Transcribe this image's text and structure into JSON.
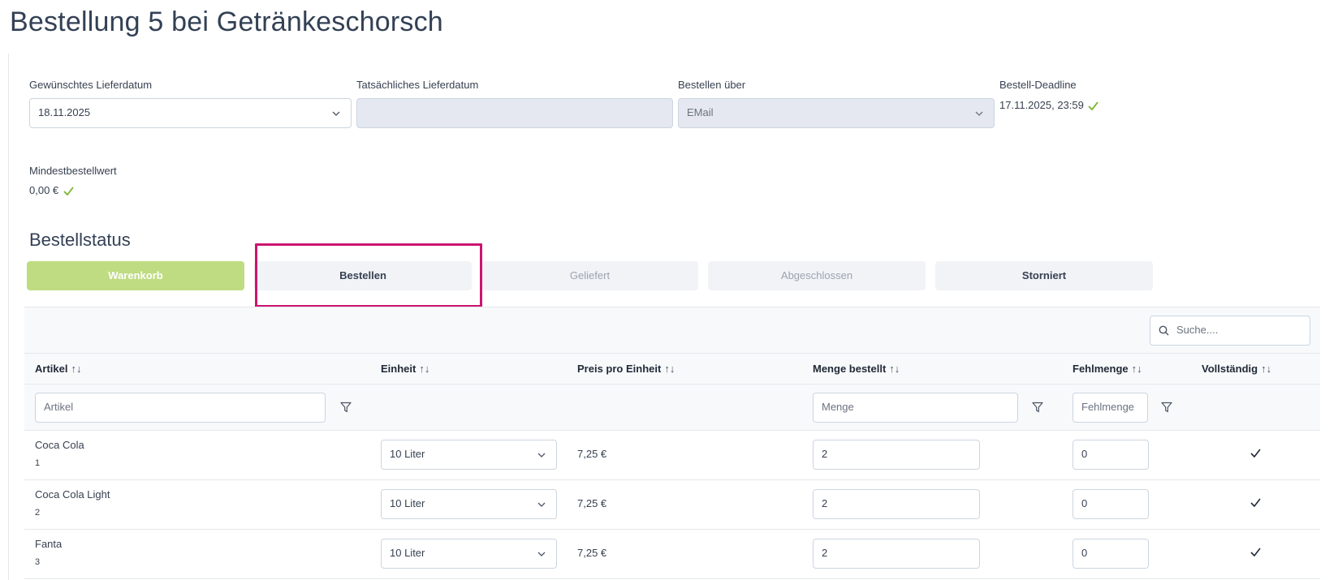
{
  "page": {
    "title": "Bestellung 5 bei Getränkeschorsch"
  },
  "fields": {
    "desired_date": {
      "label": "Gewünschtes Lieferdatum",
      "value": "18.11.2025"
    },
    "actual_date": {
      "label": "Tatsächliches Lieferdatum",
      "value": ""
    },
    "order_via": {
      "label": "Bestellen über",
      "value": "EMail"
    },
    "deadline": {
      "label": "Bestell-Deadline",
      "value": "17.11.2025, 23:59"
    },
    "min_order": {
      "label": "Mindestbestellwert",
      "value": "0,00 €"
    }
  },
  "status": {
    "title": "Bestellstatus",
    "steps": [
      {
        "label": "Warenkorb",
        "state": "active"
      },
      {
        "label": "Bestellen",
        "state": "default"
      },
      {
        "label": "Geliefert",
        "state": "muted"
      },
      {
        "label": "Abgeschlossen",
        "state": "muted"
      },
      {
        "label": "Storniert",
        "state": "default"
      }
    ]
  },
  "table": {
    "search_placeholder": "Suche....",
    "sort_icon": "↑↓",
    "columns": [
      "Artikel",
      "Einheit",
      "Preis pro Einheit",
      "Menge bestellt",
      "Fehlmenge",
      "Vollständig"
    ],
    "filters": {
      "artikel": "Artikel",
      "menge": "Menge",
      "fehlmenge": "Fehlmenge"
    },
    "rows": [
      {
        "name": "Coca Cola",
        "id": "1",
        "unit": "10 Liter",
        "price": "7,25 €",
        "qty": "2",
        "missing": "0"
      },
      {
        "name": "Coca Cola Light",
        "id": "2",
        "unit": "10 Liter",
        "price": "7,25 €",
        "qty": "2",
        "missing": "0"
      },
      {
        "name": "Fanta",
        "id": "3",
        "unit": "10 Liter",
        "price": "7,25 €",
        "qty": "2",
        "missing": "0"
      }
    ]
  },
  "colors": {
    "accent_green": "#bfdc82",
    "check_green": "#7ab32e",
    "highlight": "#cc1470"
  }
}
